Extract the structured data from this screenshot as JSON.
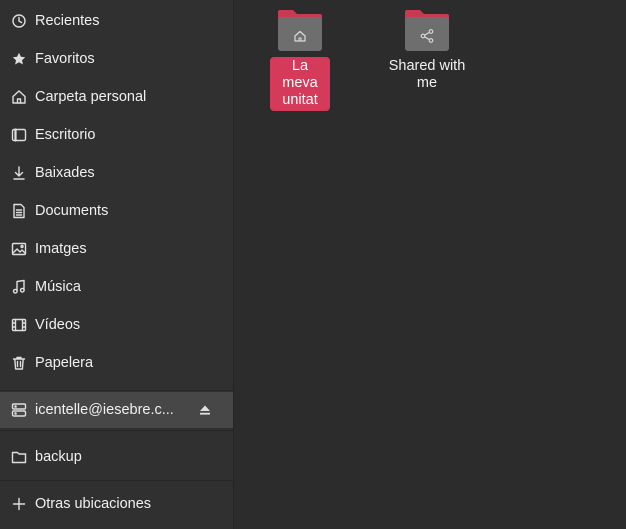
{
  "sidebar": {
    "items": [
      {
        "label": "Recientes",
        "icon": "clock-icon"
      },
      {
        "label": "Favoritos",
        "icon": "star-icon"
      },
      {
        "label": "Carpeta personal",
        "icon": "home-icon"
      },
      {
        "label": "Escritorio",
        "icon": "desktop-icon"
      },
      {
        "label": "Baixades",
        "icon": "download-icon"
      },
      {
        "label": "Documents",
        "icon": "document-icon"
      },
      {
        "label": "Imatges",
        "icon": "image-icon"
      },
      {
        "label": "Música",
        "icon": "music-icon"
      },
      {
        "label": "Vídeos",
        "icon": "video-icon"
      },
      {
        "label": "Papelera",
        "icon": "trash-icon"
      }
    ],
    "mounted": {
      "label": "icentelle@iesebre.c...",
      "icon": "drive-icon",
      "eject_icon": "eject-icon"
    },
    "bookmark": {
      "label": "backup",
      "icon": "folder-icon"
    },
    "other": {
      "label": "Otras ubicaciones",
      "icon": "plus-icon"
    }
  },
  "main": {
    "folders": [
      {
        "label": "La meva unitat",
        "icon": "home-folder-icon",
        "selected": true
      },
      {
        "label": "Shared with me",
        "icon": "shared-folder-icon",
        "selected": false
      }
    ]
  },
  "colors": {
    "accent": "#d53a5a",
    "folder_tab": "#c73a52",
    "folder_body": "#6e6e6e"
  }
}
